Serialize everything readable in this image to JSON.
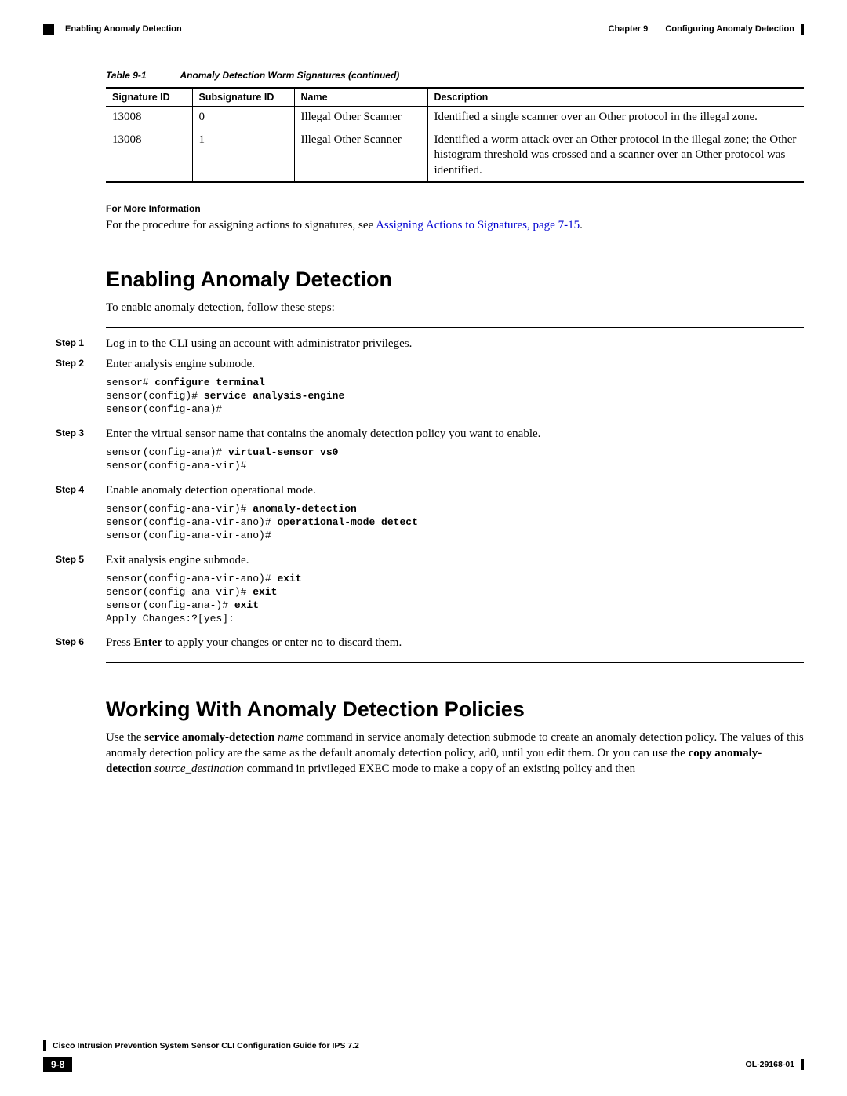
{
  "header": {
    "chapter_label": "Chapter 9",
    "chapter_title": "Configuring Anomaly Detection",
    "section_label": "Enabling Anomaly Detection"
  },
  "table": {
    "label": "Table 9-1",
    "caption": "Anomaly Detection Worm Signatures (continued)",
    "columns": [
      "Signature ID",
      "Subsignature ID",
      "Name",
      "Description"
    ],
    "rows": [
      {
        "sig_id": "13008",
        "subsig_id": "0",
        "name": "Illegal Other Scanner",
        "desc": "Identified a single scanner over an Other protocol in the illegal zone."
      },
      {
        "sig_id": "13008",
        "subsig_id": "1",
        "name": "Illegal Other Scanner",
        "desc": "Identified a worm attack over an Other protocol in the illegal zone; the Other histogram threshold was crossed and a scanner over an Other protocol was identified."
      }
    ]
  },
  "more_info": {
    "heading": "For More Information",
    "text_before": "For the procedure for assigning actions to signatures, see ",
    "link_text": "Assigning Actions to Signatures, page 7-15",
    "text_after": "."
  },
  "section1": {
    "title": "Enabling Anomaly Detection",
    "intro": "To enable anomaly detection, follow these steps:",
    "steps": [
      {
        "label": "Step 1",
        "text": "Log in to the CLI using an account with administrator privileges."
      },
      {
        "label": "Step 2",
        "text": "Enter analysis engine submode.",
        "code_lines": [
          {
            "pre": "sensor# ",
            "bold": "configure terminal",
            "post": ""
          },
          {
            "pre": "sensor(config)# ",
            "bold": "service analysis-engine",
            "post": ""
          },
          {
            "pre": "sensor(config-ana)#",
            "bold": "",
            "post": ""
          }
        ]
      },
      {
        "label": "Step 3",
        "text": "Enter the virtual sensor name that contains the anomaly detection policy you want to enable.",
        "code_lines": [
          {
            "pre": "sensor(config-ana)# ",
            "bold": "virtual-sensor vs0",
            "post": ""
          },
          {
            "pre": "sensor(config-ana-vir)#",
            "bold": "",
            "post": ""
          }
        ]
      },
      {
        "label": "Step 4",
        "text": "Enable anomaly detection operational mode.",
        "code_lines": [
          {
            "pre": "sensor(config-ana-vir)# ",
            "bold": "anomaly-detection",
            "post": ""
          },
          {
            "pre": "sensor(config-ana-vir-ano)# ",
            "bold": "operational-mode detect",
            "post": ""
          },
          {
            "pre": "sensor(config-ana-vir-ano)#",
            "bold": "",
            "post": ""
          }
        ]
      },
      {
        "label": "Step 5",
        "text": "Exit analysis engine submode.",
        "code_lines": [
          {
            "pre": "sensor(config-ana-vir-ano)# ",
            "bold": "exit",
            "post": ""
          },
          {
            "pre": "sensor(config-ana-vir)# ",
            "bold": "exit",
            "post": ""
          },
          {
            "pre": "sensor(config-ana-)# ",
            "bold": "exit",
            "post": ""
          },
          {
            "pre": "Apply Changes:?[yes]:",
            "bold": "",
            "post": ""
          }
        ]
      },
      {
        "label": "Step 6",
        "rich": {
          "t0": "Press ",
          "b0": "Enter",
          "t1": " to apply your changes or enter ",
          "m0": "no",
          "t2": " to discard them."
        }
      }
    ]
  },
  "section2": {
    "title": "Working With Anomaly Detection Policies",
    "para": {
      "t0": "Use the ",
      "b0": "service anomaly-detection",
      "t1": " ",
      "i0": "name",
      "t2": " command in service anomaly detection submode to create an anomaly detection policy. The values of this anomaly detection policy are the same as the default anomaly detection policy, ad0, until you edit them. Or you can use the ",
      "b1": "copy anomaly-detection",
      "t3": " ",
      "i1": "source_destination",
      "t4": " command in privileged EXEC mode to make a copy of an existing policy and then"
    }
  },
  "footer": {
    "guide_title": "Cisco Intrusion Prevention System Sensor CLI Configuration Guide for IPS 7.2",
    "page_number": "9-8",
    "doc_id": "OL-29168-01"
  }
}
